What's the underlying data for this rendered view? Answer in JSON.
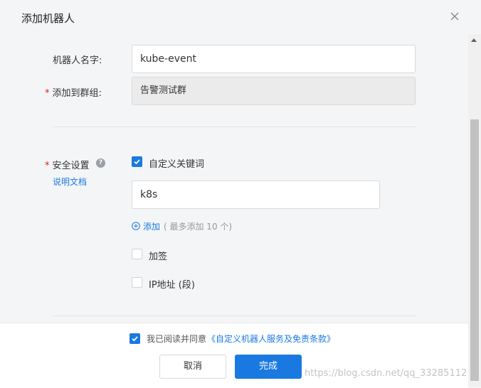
{
  "dialog": {
    "title": "添加机器人"
  },
  "form": {
    "robot_name_label": "机器人名字:",
    "robot_name_value": "kube-event",
    "group_required_mark": "*",
    "group_label": "添加到群组:",
    "group_value": "告警测试群",
    "security_required_mark": "*",
    "security_label": "安全设置",
    "help_glyph": "?",
    "doc_link": "说明文档",
    "custom_keyword_label": "自定义关键词",
    "custom_keyword_checked": true,
    "keyword_value": "k8s",
    "add_link": "添加",
    "add_hint": "( 最多添加 10 个)",
    "sign_label": "加签",
    "sign_checked": false,
    "ip_label": "IP地址 (段)",
    "ip_checked": false
  },
  "footer": {
    "agree_checked": true,
    "agree_text": "我已阅读并同意",
    "terms_link": "《自定义机器人服务及免责条款》",
    "cancel_label": "取消",
    "done_label": "完成"
  },
  "watermark": "https://blog.csdn.net/qq_33285112",
  "colors": {
    "accent": "#1a79e0",
    "required": "#e02020"
  },
  "icons": {
    "close": "close-icon",
    "help": "help-icon",
    "add": "plus-circle-icon",
    "check": "check-icon"
  }
}
